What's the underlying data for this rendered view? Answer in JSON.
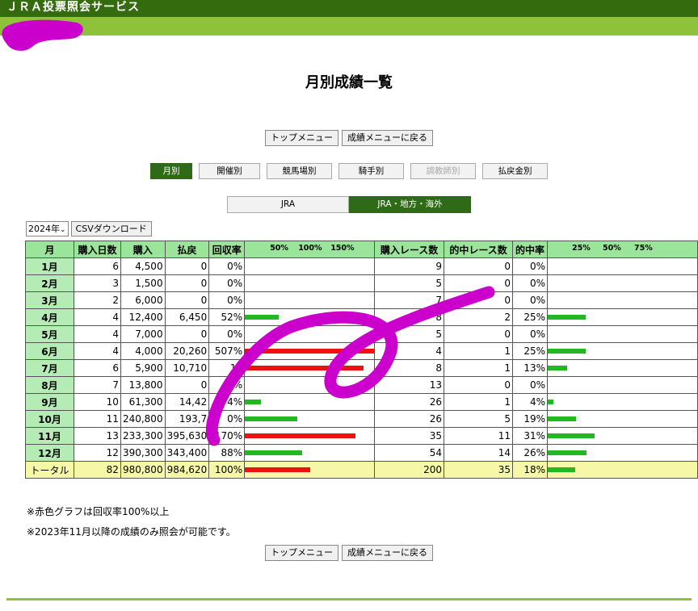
{
  "header": {
    "title": "ＪＲＡ投票照会サービス"
  },
  "page_title": "月別成績一覧",
  "nav": {
    "top_menu": "トップメニュー",
    "back_results_menu": "成績メニューに戻る"
  },
  "categories": [
    {
      "label": "月別",
      "active": true,
      "disabled": false
    },
    {
      "label": "開催別",
      "active": false,
      "disabled": false
    },
    {
      "label": "競馬場別",
      "active": false,
      "disabled": false
    },
    {
      "label": "騎手別",
      "active": false,
      "disabled": false
    },
    {
      "label": "調教師別",
      "active": false,
      "disabled": true
    },
    {
      "label": "払戻金別",
      "active": false,
      "disabled": false
    }
  ],
  "organizations": [
    {
      "label": "JRA",
      "active": false
    },
    {
      "label": "JRA・地方・海外",
      "active": true
    }
  ],
  "year_select": {
    "value": "2024年"
  },
  "csv_button": "CSVダウンロード",
  "table": {
    "headers": {
      "month": "月",
      "days": "購入日数",
      "purchase": "購入",
      "payout": "払戻",
      "return_rate": "回収率",
      "return_scale": [
        "50%",
        "100%",
        "150%"
      ],
      "races": "購入レース数",
      "hits": "的中レース数",
      "hit_rate": "的中率",
      "hit_scale": [
        "25%",
        "50%",
        "75%"
      ]
    },
    "rows": [
      {
        "month": "1月",
        "days": "6",
        "purchase": "4,500",
        "payout": "0",
        "return_rate": "0%",
        "return_pct": 0,
        "races": "9",
        "hits": "0",
        "hit_rate": "0%",
        "hit_pct": 0
      },
      {
        "month": "2月",
        "days": "3",
        "purchase": "1,500",
        "payout": "0",
        "return_rate": "0%",
        "return_pct": 0,
        "races": "5",
        "hits": "0",
        "hit_rate": "0%",
        "hit_pct": 0
      },
      {
        "month": "3月",
        "days": "2",
        "purchase": "6,000",
        "payout": "0",
        "return_rate": "0%",
        "return_pct": 0,
        "races": "7",
        "hits": "0",
        "hit_rate": "0%",
        "hit_pct": 0
      },
      {
        "month": "4月",
        "days": "4",
        "purchase": "12,400",
        "payout": "6,450",
        "return_rate": "52%",
        "return_pct": 52,
        "races": "8",
        "hits": "2",
        "hit_rate": "25%",
        "hit_pct": 25
      },
      {
        "month": "5月",
        "days": "4",
        "purchase": "7,000",
        "payout": "0",
        "return_rate": "0%",
        "return_pct": 0,
        "races": "5",
        "hits": "0",
        "hit_rate": "0%",
        "hit_pct": 0
      },
      {
        "month": "6月",
        "days": "4",
        "purchase": "4,000",
        "payout": "20,260",
        "return_rate": "507%",
        "return_pct": 507,
        "races": "4",
        "hits": "1",
        "hit_rate": "25%",
        "hit_pct": 25
      },
      {
        "month": "7月",
        "days": "6",
        "purchase": "5,900",
        "payout": "10,710",
        "return_rate": "18",
        "return_pct": 182,
        "races": "8",
        "hits": "1",
        "hit_rate": "13%",
        "hit_pct": 13
      },
      {
        "month": "8月",
        "days": "7",
        "purchase": "13,800",
        "payout": "0",
        "return_rate": "%",
        "return_pct": 0,
        "races": "13",
        "hits": "0",
        "hit_rate": "0%",
        "hit_pct": 0
      },
      {
        "month": "9月",
        "days": "10",
        "purchase": "61,300",
        "payout": "14,42",
        "return_rate": "4%",
        "return_pct": 24,
        "races": "26",
        "hits": "1",
        "hit_rate": "4%",
        "hit_pct": 4
      },
      {
        "month": "10月",
        "days": "11",
        "purchase": "240,800",
        "payout": "193,7",
        "return_rate": "0%",
        "return_pct": 80,
        "races": "26",
        "hits": "5",
        "hit_rate": "19%",
        "hit_pct": 19
      },
      {
        "month": "11月",
        "days": "13",
        "purchase": "233,300",
        "payout": "395,630",
        "return_rate": "170%",
        "return_pct": 170,
        "races": "35",
        "hits": "11",
        "hit_rate": "31%",
        "hit_pct": 31
      },
      {
        "month": "12月",
        "days": "12",
        "purchase": "390,300",
        "payout": "343,400",
        "return_rate": "88%",
        "return_pct": 88,
        "races": "54",
        "hits": "14",
        "hit_rate": "26%",
        "hit_pct": 26
      }
    ],
    "total": {
      "month": "トータル",
      "days": "82",
      "purchase": "980,800",
      "payout": "984,620",
      "return_rate": "100%",
      "return_pct": 100,
      "races": "200",
      "hits": "35",
      "hit_rate": "18%",
      "hit_pct": 18
    }
  },
  "notes": [
    "※赤色グラフは回収率100%以上",
    "※2023年11月以降の成績のみ照会が可能です。"
  ],
  "colors": {
    "header": "#356b0f",
    "subbar": "#8fc23b",
    "bar_green": "#22b822",
    "bar_red": "#ee1111",
    "scribble": "#cc00cc"
  }
}
